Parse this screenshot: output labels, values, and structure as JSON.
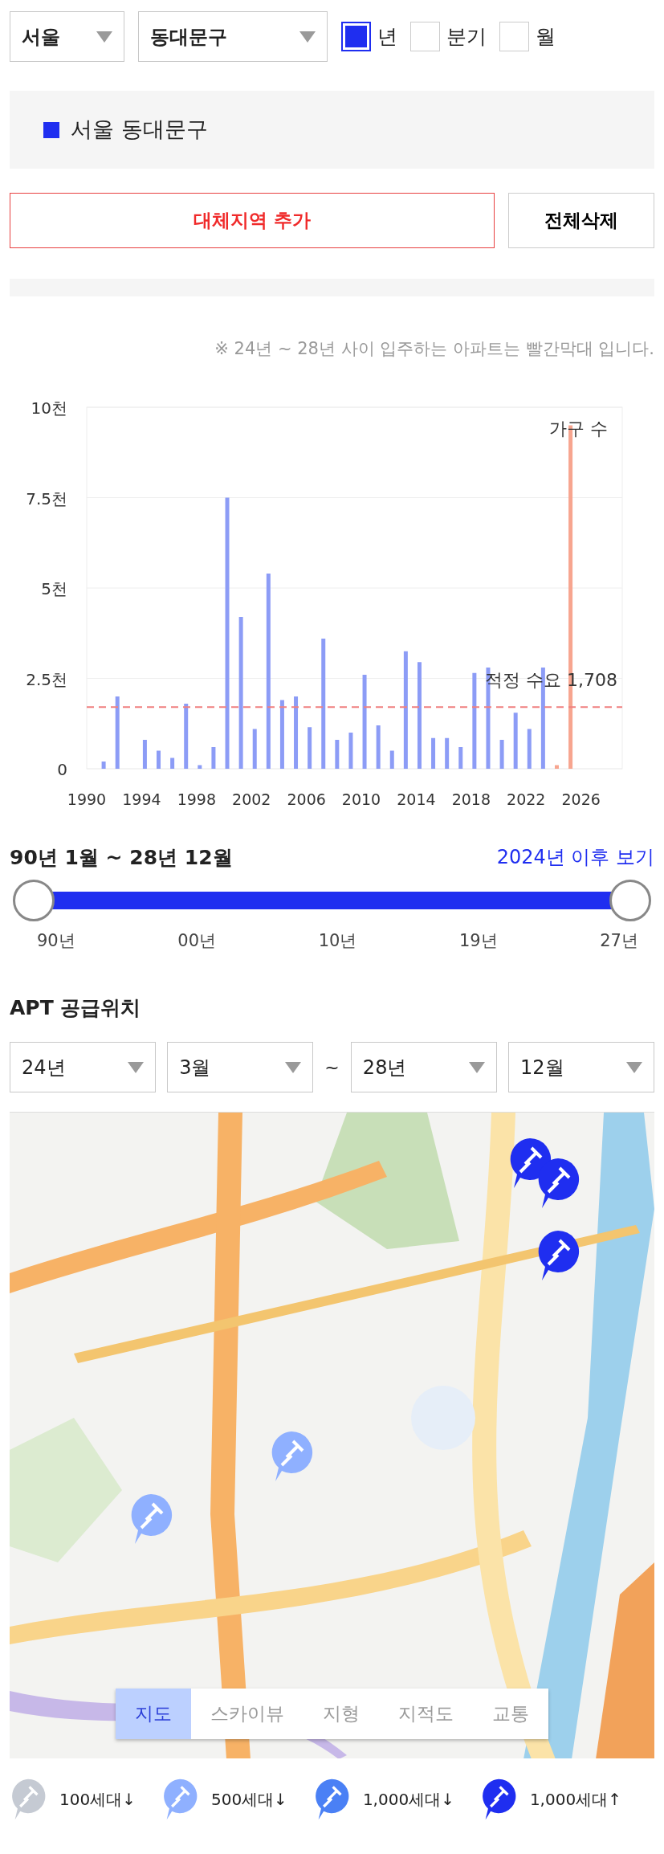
{
  "filters": {
    "selects": [
      {
        "value": "서울"
      },
      {
        "value": "동대문구"
      }
    ],
    "periods": [
      {
        "label": "년",
        "checked": true
      },
      {
        "label": "분기",
        "checked": false
      },
      {
        "label": "월",
        "checked": false
      }
    ]
  },
  "selected_regions": [
    {
      "label": "서울 동대문구",
      "color": "#1f2ef0"
    }
  ],
  "buttons": [
    {
      "label": "대체지역 추가",
      "kind": "accent"
    },
    {
      "label": "전체삭제",
      "kind": "plain"
    }
  ],
  "chart_note": "※ 24년 ~ 28년 사이 입주하는 아파트는 빨간막대 입니다.",
  "chart_data": {
    "type": "bar",
    "x": [
      1991,
      1992,
      1994,
      1995,
      1996,
      1997,
      1998,
      1999,
      2000,
      2001,
      2002,
      2003,
      2004,
      2005,
      2006,
      2007,
      2008,
      2009,
      2010,
      2011,
      2012,
      2013,
      2014,
      2015,
      2016,
      2017,
      2018,
      2019,
      2020,
      2021,
      2022,
      2023,
      2024,
      2025
    ],
    "series": [
      {
        "color": "#8c9cf6",
        "values": [
          0.2,
          2.0,
          0.8,
          0.5,
          0.3,
          1.8,
          0.1,
          0.6,
          7.5,
          4.2,
          1.1,
          5.4,
          1.9,
          2.0,
          1.15,
          3.6,
          0.8,
          1.0,
          2.6,
          1.2,
          0.5,
          3.25,
          2.95,
          0.85,
          0.85,
          0.6,
          2.65,
          2.8,
          0.8,
          1.55,
          1.1,
          2.8,
          null,
          null
        ]
      },
      {
        "color": "#f7a58f",
        "values": [
          null,
          null,
          null,
          null,
          null,
          null,
          null,
          null,
          null,
          null,
          null,
          null,
          null,
          null,
          null,
          null,
          null,
          null,
          null,
          null,
          null,
          null,
          null,
          null,
          null,
          null,
          null,
          null,
          null,
          null,
          null,
          null,
          0.1,
          9.5
        ]
      }
    ],
    "xlim": [
      1990,
      2029
    ],
    "ylim": [
      0,
      10
    ],
    "xticks": [
      1990,
      1994,
      1998,
      2002,
      2006,
      2010,
      2014,
      2018,
      2022,
      2026
    ],
    "yticks": [
      {
        "value": 0,
        "label": "0"
      },
      {
        "value": 2.5,
        "label": "2.5천"
      },
      {
        "value": 5,
        "label": "5천"
      },
      {
        "value": 7.5,
        "label": "7.5천"
      },
      {
        "value": 10,
        "label": "10천"
      }
    ],
    "annotations": [
      "가구 수"
    ],
    "ref_lines": [
      {
        "axis": "y",
        "value": 1.708,
        "label": "적정 수요 1,708"
      }
    ],
    "grid": true
  },
  "range": {
    "title": "90년 1월 ~ 28년 12월",
    "link": "2024년 이후 보기",
    "thumbs": [
      {
        "level": 0
      },
      {
        "level": 1
      }
    ],
    "ticks": [
      "90년",
      "00년",
      "10년",
      "19년",
      "27년"
    ]
  },
  "location": {
    "title": "APT 공급위치",
    "selects": [
      {
        "value": "24년"
      },
      {
        "value": "3월"
      },
      {
        "value": "~",
        "kind": "separator"
      },
      {
        "value": "28년"
      },
      {
        "value": "12월"
      }
    ],
    "markers": [
      {
        "color": "#1f2ef0"
      },
      {
        "color": "#1f2ef0"
      },
      {
        "color": "#1f2ef0"
      },
      {
        "color": "#8fb0ff"
      },
      {
        "color": "#8fb0ff"
      }
    ],
    "map_tabs": [
      {
        "label": "지도",
        "selected": true
      },
      {
        "label": "스카이뷰",
        "selected": false
      },
      {
        "label": "지형",
        "selected": false
      },
      {
        "label": "지적도",
        "selected": false
      },
      {
        "label": "교통",
        "selected": false
      }
    ]
  },
  "legend": [
    {
      "label": "100세대↓",
      "color": "#c5cad3"
    },
    {
      "label": "500세대↓",
      "color": "#8fb0ff"
    },
    {
      "label": "1,000세대↓",
      "color": "#4a80f5"
    },
    {
      "label": "1,000세대↑",
      "color": "#1f2ef0"
    }
  ]
}
